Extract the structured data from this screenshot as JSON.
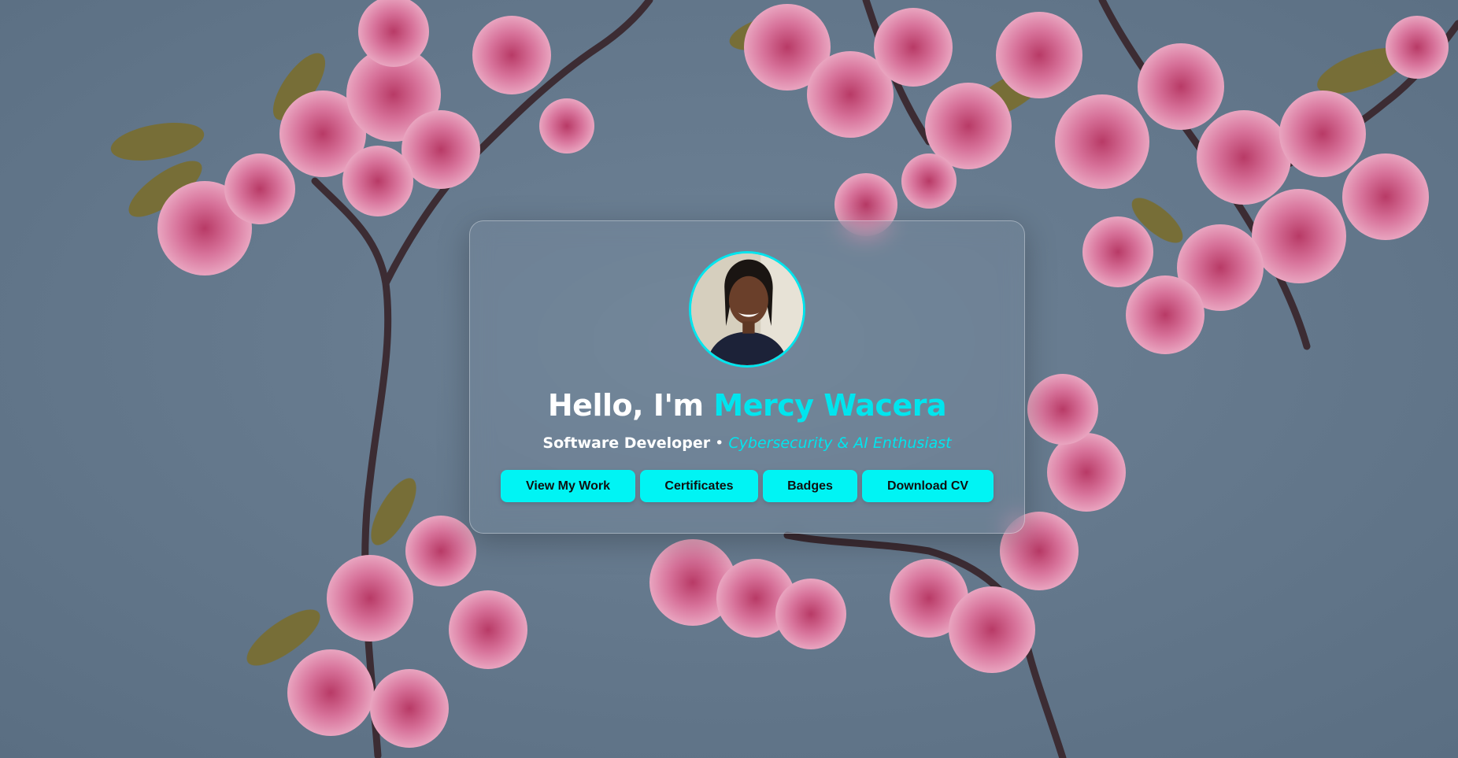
{
  "hero": {
    "greeting": "Hello, I'm ",
    "name": "Mercy Wacera",
    "role": "Software Developer",
    "separator": " • ",
    "interests": "Cybersecurity & AI Enthusiast"
  },
  "buttons": [
    {
      "label": "View My Work"
    },
    {
      "label": "Certificates"
    },
    {
      "label": "Badges"
    },
    {
      "label": "Download CV"
    }
  ],
  "colors": {
    "accent": "#00e5ee",
    "button_bg": "#00f4f4",
    "background_sky": "#667a8d",
    "blossom": "#d06a92"
  },
  "background": {
    "icon": "cherry-blossom-branch"
  },
  "avatar": {
    "icon": "profile-photo"
  }
}
